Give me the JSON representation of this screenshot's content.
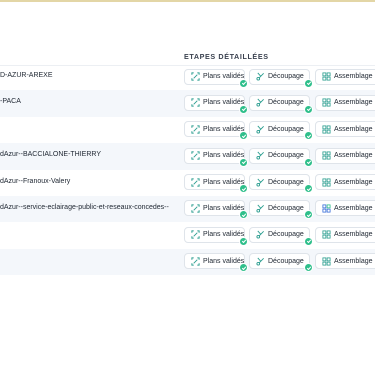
{
  "header": {
    "steps_title": "ETAPES DÉTAILLÉES"
  },
  "colors": {
    "accent_green": "#2fbf8b",
    "icon_teal": "#2a9d8f",
    "icon_blue": "#3a6fd8",
    "top_rule": "#e3d6a6"
  },
  "step_labels": {
    "plans": "Plans validés",
    "decoupage": "Découpage",
    "assemblage": "Assemblage"
  },
  "rows": [
    {
      "name": "D-AZUR-AREXE",
      "plans_done": true,
      "decoupage_done": true,
      "assemblage_done": true,
      "assemblage_icon": "grid-check-icon"
    },
    {
      "name": "-PACA",
      "plans_done": true,
      "decoupage_done": true,
      "assemblage_done": true,
      "assemblage_icon": "grid-check-icon"
    },
    {
      "name": "",
      "plans_done": true,
      "decoupage_done": true,
      "assemblage_done": true,
      "assemblage_icon": "grid-check-icon"
    },
    {
      "name": "dAzur--BACCIALONE-THIERRY",
      "plans_done": true,
      "decoupage_done": true,
      "assemblage_done": true,
      "assemblage_icon": "grid-check-icon"
    },
    {
      "name": "dAzur--Franoux-Valery",
      "plans_done": true,
      "decoupage_done": true,
      "assemblage_done": true,
      "assemblage_icon": "grid-check-icon"
    },
    {
      "name": "dAzur--service-eclairage-public-et-reseaux-concedes--",
      "plans_done": true,
      "decoupage_done": true,
      "assemblage_done": false,
      "assemblage_icon": "grid-blue-icon"
    },
    {
      "name": "",
      "plans_done": true,
      "decoupage_done": true,
      "assemblage_done": true,
      "assemblage_icon": "grid-check-icon"
    },
    {
      "name": "",
      "plans_done": true,
      "decoupage_done": true,
      "assemblage_done": true,
      "assemblage_icon": "grid-check-icon"
    }
  ]
}
